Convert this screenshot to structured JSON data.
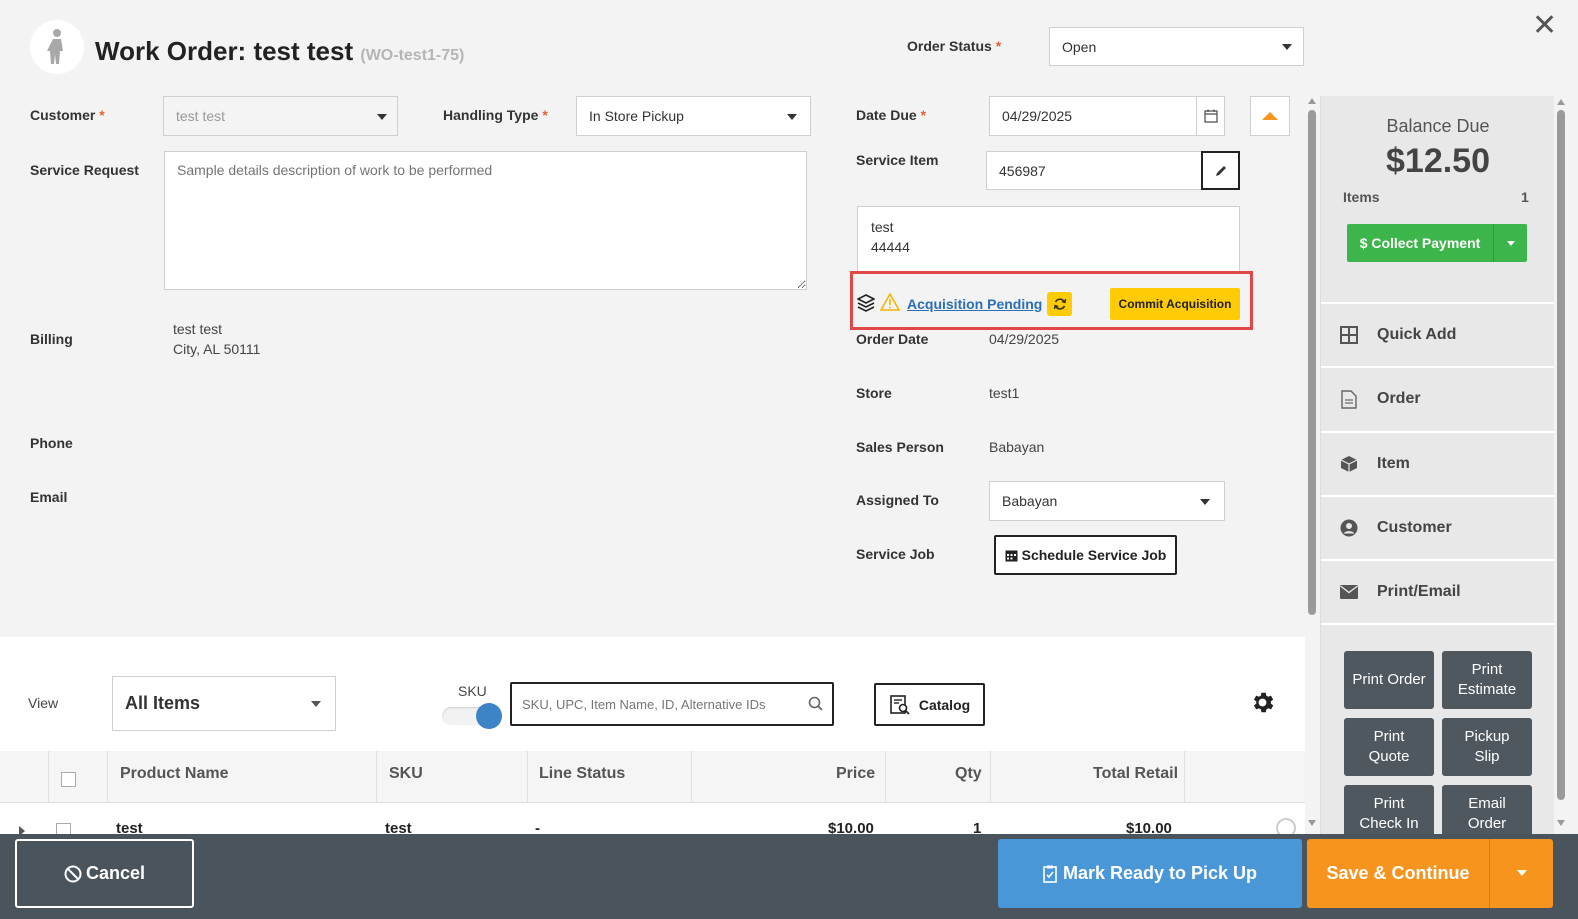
{
  "header": {
    "title": "Work Order: test test",
    "order_id": "(WO-test1-75)",
    "order_status_label": "Order Status",
    "order_status_value": "Open",
    "required_mark": "*"
  },
  "form": {
    "customer_label": "Customer",
    "customer_value": "test test",
    "handling_type_label": "Handling Type",
    "handling_type_value": "In Store Pickup",
    "service_request_label": "Service Request",
    "service_request_placeholder": "Sample details description of work to be performed",
    "billing_label": "Billing",
    "billing_line1": "test test",
    "billing_line2": "City, AL 50111",
    "phone_label": "Phone",
    "email_label": "Email"
  },
  "details": {
    "date_due_label": "Date Due",
    "date_due_value": "04/29/2025",
    "service_item_label": "Service Item",
    "service_item_value": "456987",
    "item_desc_line1": "test",
    "item_desc_line2": "44444",
    "acquisition_pending": "Acquisition Pending",
    "commit_acquisition": "Commit Acquisition",
    "order_date_label": "Order Date",
    "order_date_value": "04/29/2025",
    "store_label": "Store",
    "store_value": "test1",
    "sales_person_label": "Sales Person",
    "sales_person_value": "Babayan",
    "assigned_to_label": "Assigned To",
    "assigned_to_value": "Babayan",
    "service_job_label": "Service Job",
    "schedule_service_job": "Schedule Service Job"
  },
  "sidebar": {
    "balance_label": "Balance Due",
    "balance_value": "$12.50",
    "items_label": "Items",
    "items_count": "1",
    "collect_payment": "$ Collect Payment",
    "menu": [
      {
        "label": "Quick Add",
        "icon": "grid-icon"
      },
      {
        "label": "Order",
        "icon": "document-icon"
      },
      {
        "label": "Item",
        "icon": "box-icon"
      },
      {
        "label": "Customer",
        "icon": "user-circle-icon"
      },
      {
        "label": "Print/Email",
        "icon": "envelope-icon"
      }
    ],
    "print_buttons": [
      "Print Order",
      "Print\nEstimate",
      "Print\nQuote",
      "Pickup\nSlip",
      "Print\nCheck In",
      "Email\nOrder"
    ]
  },
  "items": {
    "view_label": "View",
    "view_value": "All Items",
    "sku_toggle_label": "SKU",
    "search_placeholder": "SKU, UPC, Item Name, ID, Alternative IDs",
    "catalog_label": "Catalog",
    "columns": [
      "Product Name",
      "SKU",
      "Line Status",
      "Price",
      "Qty",
      "Total Retail"
    ],
    "rows": [
      {
        "name": "test",
        "sku": "test",
        "status": "-",
        "price": "$10.00",
        "qty": "1",
        "total": "$10.00"
      }
    ]
  },
  "footer": {
    "cancel": "Cancel",
    "mark_ready": "Mark Ready to Pick Up",
    "save_continue": "Save & Continue"
  },
  "colors": {
    "accent_orange": "#f7941d",
    "green": "#3cb54a",
    "blue": "#4a97d8",
    "yellow": "#ffcb05",
    "highlight_red": "#e04848"
  }
}
